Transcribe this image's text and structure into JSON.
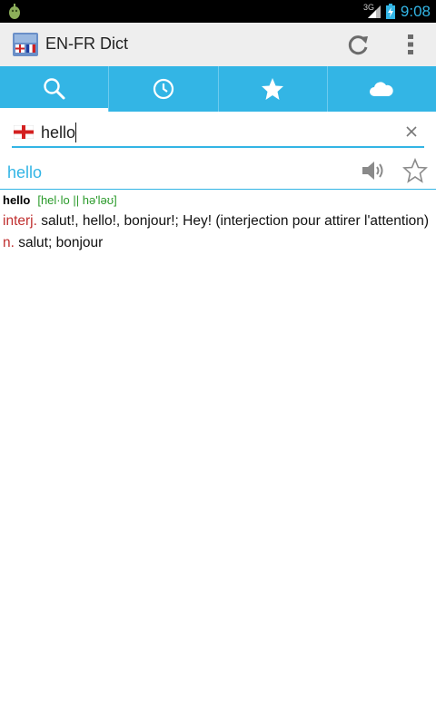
{
  "status_bar": {
    "network": "3G",
    "time": "9:08"
  },
  "action_bar": {
    "title": "EN-FR Dict",
    "icons": [
      "app-dictionary-icon",
      "refresh-icon",
      "overflow-menu-icon"
    ]
  },
  "tabs": [
    {
      "name": "search",
      "icon": "search-icon",
      "active": true
    },
    {
      "name": "history",
      "icon": "clock-icon",
      "active": false
    },
    {
      "name": "favorites",
      "icon": "star-icon",
      "active": false
    },
    {
      "name": "cloud",
      "icon": "cloud-icon",
      "active": false
    }
  ],
  "search": {
    "value": "hello",
    "language_flag": "england-flag-icon"
  },
  "entry": {
    "word": "hello",
    "headword": "hello",
    "pronunciation": "[hel·lo || hə'ləʊ]",
    "senses": [
      {
        "pos": "interj.",
        "text": " salut!, hello!, bonjour!; Hey! (interjection pour attirer l'attention)"
      },
      {
        "pos": "n.",
        "text": " salut; bonjour"
      }
    ]
  },
  "colors": {
    "accent": "#33b5e5",
    "pos": "#c03030",
    "pronunciation": "#2a9a2a"
  }
}
